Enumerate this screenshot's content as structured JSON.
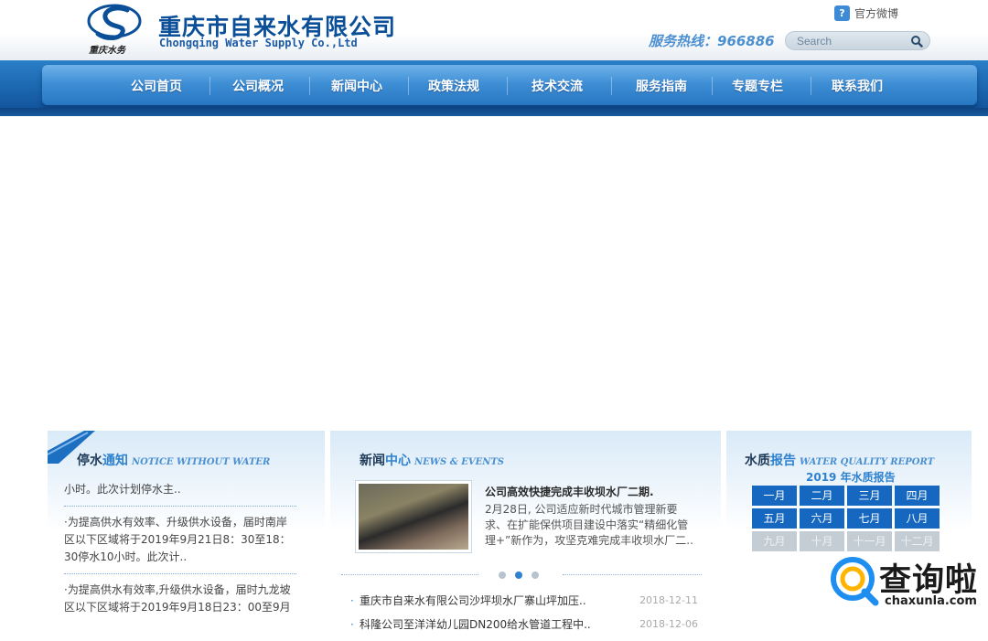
{
  "header": {
    "company_cn": "重庆市自来水有限公司",
    "company_en": "Chongqing Water Supply Co.,Ltd",
    "logo_script": "重庆水务",
    "weibo_label": "官方微博",
    "hotline": "服务热线：966886",
    "search_placeholder": "Search"
  },
  "nav": {
    "items": [
      "公司首页",
      "公司概况",
      "新闻中心",
      "政策法规",
      "技术交流",
      "服务指南",
      "专题专栏",
      "联系我们"
    ]
  },
  "notice": {
    "title_a": "停水",
    "title_b": "通知",
    "title_en": "NOTICE WITHOUT WATER",
    "items": [
      "小时。此次计划停水主..",
      "·为提高供水有效率、升级供水设备，届时南岸区以下区域将于2019年9月21日8：30至18：30停水10小时。此次计..",
      "·为提高供水有效率,升级供水设备，届时九龙坡区以下区域将于2019年9月18日23：00至9月"
    ]
  },
  "news": {
    "title_a": "新闻",
    "title_b": "中心",
    "title_en": "NEWS & EVENTS",
    "featured_title": "公司高效快捷完成丰收坝水厂二期.",
    "featured_body": "2月28日, 公司适应新时代城市管理新要求、在扩能保供项目建设中落实“精细化管理+”新作为，攻坚克难完成丰收坝水厂二..",
    "list": [
      {
        "title": "重庆市自来水有限公司沙坪坝水厂寨山坪加压..",
        "date": "2018-12-11"
      },
      {
        "title": "科隆公司至洋洋幼儿园DN200给水管道工程中..",
        "date": "2018-12-06"
      }
    ]
  },
  "water_quality": {
    "title_a": "水质",
    "title_b": "报告",
    "title_en": "WATER QUALITY REPORT",
    "year_label": "2019 年水质报告",
    "months": [
      "一月",
      "二月",
      "三月",
      "四月",
      "五月",
      "六月",
      "七月",
      "八月",
      "九月",
      "十月",
      "十一月",
      "十二月"
    ],
    "active_months": 8
  },
  "watermark": {
    "text": "查询啦",
    "url": "chaxunla.com"
  }
}
